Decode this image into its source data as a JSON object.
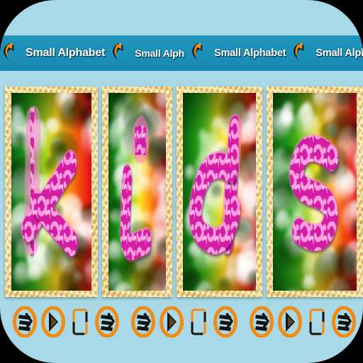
{
  "app": {
    "background_color": "#000000",
    "card_color": "#a9d9e7",
    "header_color": "#1a90b8",
    "accent_color": "#f08c15",
    "letter_color": "#d81fa8"
  },
  "header": {
    "items": [
      {
        "label": "Small Alphabet",
        "icon": "undo-arrow-icon"
      },
      {
        "label": "Small Alph",
        "icon": "undo-arrow-icon"
      },
      {
        "label": "Small Alphabet",
        "icon": "undo-arrow-icon"
      },
      {
        "label": "Small Alphabet",
        "icon": "undo-arrow-icon"
      }
    ],
    "trailing_icon": "undo-arrow-icon"
  },
  "gallery": {
    "word": "kids",
    "panels": [
      {
        "letter": "k",
        "caption": "k",
        "frame": "wicker-gold"
      },
      {
        "letter": "i",
        "caption": "i",
        "frame": "wicker-gold"
      },
      {
        "letter": "d",
        "caption": "d",
        "frame": "wicker-gold"
      },
      {
        "letter": "s",
        "caption": "s",
        "frame": "wicker-gold"
      }
    ]
  },
  "toolbar": {
    "items": [
      {
        "icon": "share-oval-icon",
        "label": "Share"
      },
      {
        "icon": "play-oval-icon",
        "label": "Play"
      },
      {
        "icon": "device-frame-icon",
        "label": "Device"
      },
      {
        "icon": "share-oval-icon",
        "label": "Share"
      },
      {
        "icon": "share-oval-icon",
        "label": "Share"
      },
      {
        "icon": "play-oval-icon",
        "label": "Play"
      },
      {
        "icon": "device-frame-icon",
        "label": "Device"
      },
      {
        "icon": "share-oval-icon",
        "label": "Share"
      },
      {
        "icon": "share-oval-icon",
        "label": "Share"
      },
      {
        "icon": "play-oval-icon",
        "label": "Play"
      },
      {
        "icon": "device-frame-icon",
        "label": "Device"
      },
      {
        "icon": "share-oval-icon",
        "label": "Share"
      },
      {
        "icon": "share-oval-icon",
        "label": "Share"
      },
      {
        "icon": "play-oval-icon",
        "label": "Play"
      },
      {
        "icon": "device-frame-icon",
        "label": "Device"
      },
      {
        "icon": "share-oval-icon",
        "label": "Share"
      }
    ]
  }
}
